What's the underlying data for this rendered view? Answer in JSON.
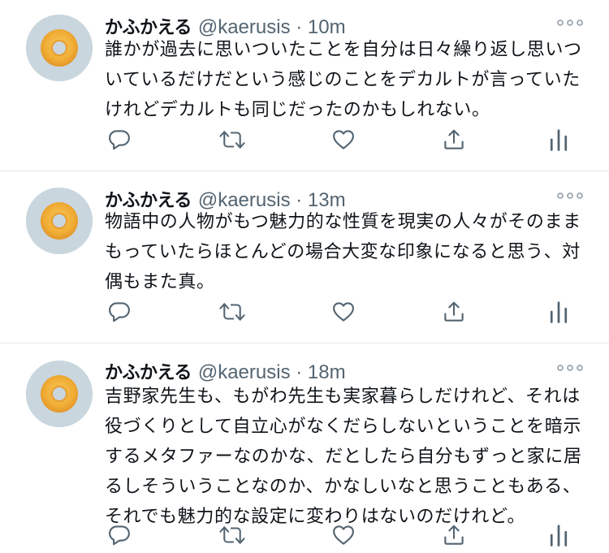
{
  "tweets": [
    {
      "author_name": "かふかえる",
      "handle": "@kaerusis",
      "time": "10m",
      "text": "誰かが過去に思いついたことを自分は日々繰り返し思いついているだけだという感じのことをデカルトが言っていたけれどデカルトも同じだったのかもしれない。",
      "avatar_icon": "donut-avatar-icon"
    },
    {
      "author_name": "かふかえる",
      "handle": "@kaerusis",
      "time": "13m",
      "text": "物語中の人物がもつ魅力的な性質を現実の人々がそのままもっていたらほとんどの場合大変な印象になると思う、対偶もまた真。",
      "avatar_icon": "donut-avatar-icon"
    },
    {
      "author_name": "かふかえる",
      "handle": "@kaerusis",
      "time": "18m",
      "text": "吉野家先生も、もがわ先生も実家暮らしだけれど、それは役づくりとして自立心がなくだらしないということを暗示するメタファーなのかな、だとしたら自分もずっと家に居るしそういうことなのか、かなしいなと思うこともある、それでも魅力的な設定に変わりはないのだけれど。",
      "avatar_icon": "donut-avatar-icon"
    }
  ],
  "separator": "·",
  "colors": {
    "text_primary": "#0f1419",
    "text_secondary": "#536471",
    "icon": "#536471",
    "divider": "#e1e6ea",
    "avatar_bg": "#c9d6de",
    "donut": "#f0b441"
  },
  "action_icons": [
    "reply-icon",
    "retweet-icon",
    "like-icon",
    "share-icon",
    "analytics-icon"
  ]
}
